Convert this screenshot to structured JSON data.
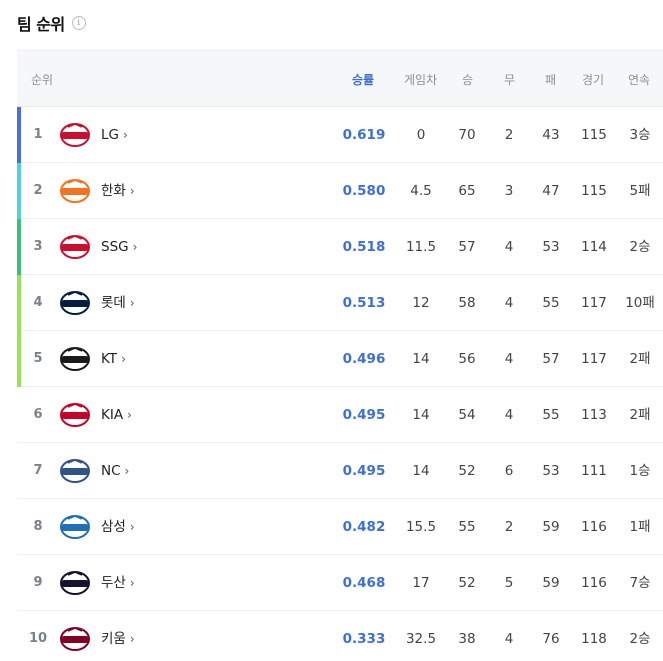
{
  "header": {
    "title": "팀 순위",
    "info_icon": "info-icon"
  },
  "columns": {
    "rank": "순위",
    "pct": "승률",
    "gb": "게임차",
    "w": "승",
    "d": "무",
    "l": "패",
    "g": "경기",
    "streak": "연속"
  },
  "colors": {
    "accent": "#3d6fd6",
    "bar_1": "#4a6fe3",
    "bar_2": "#4fd3d9",
    "bar_3": "#3bbf7a",
    "bar_45": "#9be05a"
  },
  "teams": [
    {
      "rank": "1",
      "name": "LG",
      "pct": "0.619",
      "gb": "0",
      "w": "70",
      "d": "2",
      "l": "43",
      "g": "115",
      "streak": "3승",
      "bar": "#4a6fe3",
      "logo_color": "#c8102e",
      "logo_icon": "lg-twins-logo-icon"
    },
    {
      "rank": "2",
      "name": "한화",
      "pct": "0.580",
      "gb": "4.5",
      "w": "65",
      "d": "3",
      "l": "47",
      "g": "115",
      "streak": "5패",
      "bar": "#4fd3d9",
      "logo_color": "#f37321",
      "logo_icon": "hanwha-eagles-logo-icon"
    },
    {
      "rank": "3",
      "name": "SSG",
      "pct": "0.518",
      "gb": "11.5",
      "w": "57",
      "d": "4",
      "l": "53",
      "g": "114",
      "streak": "2승",
      "bar": "#3bbf7a",
      "logo_color": "#ce0e2d",
      "logo_icon": "ssg-landers-logo-icon"
    },
    {
      "rank": "4",
      "name": "롯데",
      "pct": "0.513",
      "gb": "12",
      "w": "58",
      "d": "4",
      "l": "55",
      "g": "117",
      "streak": "10패",
      "bar": "#9be05a",
      "logo_color": "#041e42",
      "logo_icon": "lotte-giants-logo-icon"
    },
    {
      "rank": "5",
      "name": "KT",
      "pct": "0.496",
      "gb": "14",
      "w": "56",
      "d": "4",
      "l": "57",
      "g": "117",
      "streak": "2패",
      "bar": "#9be05a",
      "logo_color": "#1a1a1a",
      "logo_icon": "kt-wiz-logo-icon"
    },
    {
      "rank": "6",
      "name": "KIA",
      "pct": "0.495",
      "gb": "14",
      "w": "54",
      "d": "4",
      "l": "55",
      "g": "113",
      "streak": "2패",
      "bar": "",
      "logo_color": "#c70125",
      "logo_icon": "kia-tigers-logo-icon"
    },
    {
      "rank": "7",
      "name": "NC",
      "pct": "0.495",
      "gb": "14",
      "w": "52",
      "d": "6",
      "l": "53",
      "g": "111",
      "streak": "1승",
      "bar": "",
      "logo_color": "#315288",
      "logo_icon": "nc-dinos-logo-icon"
    },
    {
      "rank": "8",
      "name": "삼성",
      "pct": "0.482",
      "gb": "15.5",
      "w": "55",
      "d": "2",
      "l": "59",
      "g": "116",
      "streak": "1패",
      "bar": "",
      "logo_color": "#1d6fb8",
      "logo_icon": "samsung-lions-logo-icon"
    },
    {
      "rank": "9",
      "name": "두산",
      "pct": "0.468",
      "gb": "17",
      "w": "52",
      "d": "5",
      "l": "59",
      "g": "116",
      "streak": "7승",
      "bar": "",
      "logo_color": "#131230",
      "logo_icon": "doosan-bears-logo-icon"
    },
    {
      "rank": "10",
      "name": "키움",
      "pct": "0.333",
      "gb": "32.5",
      "w": "38",
      "d": "4",
      "l": "76",
      "g": "118",
      "streak": "2승",
      "bar": "",
      "logo_color": "#820024",
      "logo_icon": "kiwoom-heroes-logo-icon"
    }
  ]
}
